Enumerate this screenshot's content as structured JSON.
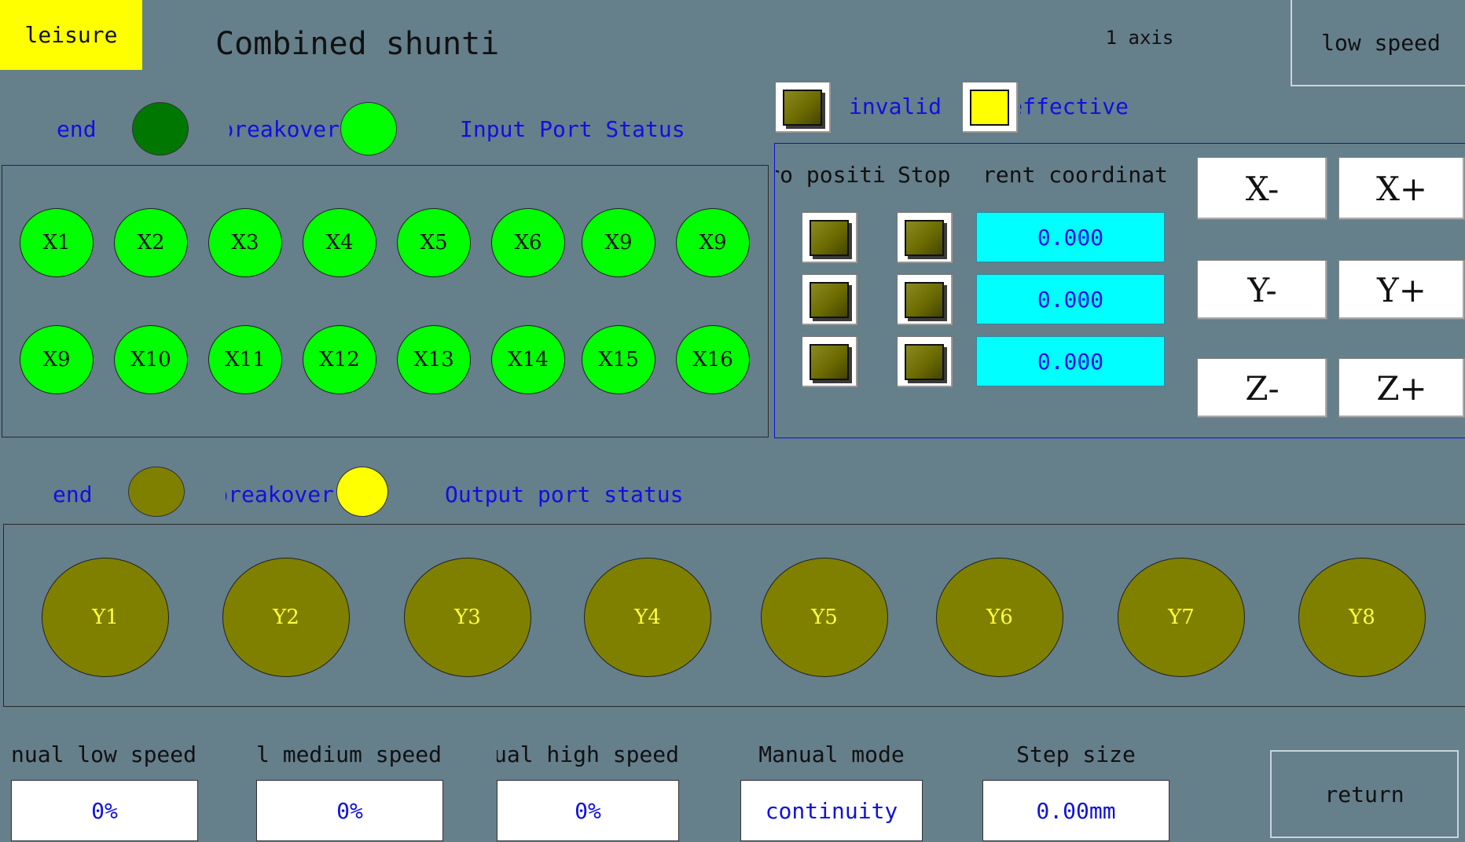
{
  "header": {
    "status": "leisure",
    "title": "Combined shunting",
    "axis": "1 axis",
    "speed_button": "low speed"
  },
  "input_legend": {
    "end_label": "end",
    "breakover_label": "breakover",
    "section_title": "Input Port Status",
    "end_color": "#007700",
    "breakover_color": "#00ff00"
  },
  "input_ports": [
    "X1",
    "X2",
    "X3",
    "X4",
    "X5",
    "X6",
    "X9",
    "X9",
    "X9",
    "X10",
    "X11",
    "X12",
    "X13",
    "X14",
    "X15",
    "X16"
  ],
  "mode_toggles": {
    "invalid_label": "one invalid",
    "effective_label": "effective"
  },
  "axis_table": {
    "headers": [
      "Zero positi",
      "Stop",
      "Current coordinat"
    ],
    "coordinates": [
      "0.000",
      "0.000",
      "0.000"
    ]
  },
  "jog_buttons": [
    "X-",
    "X+",
    "Y-",
    "Y+",
    "Z-",
    "Z+"
  ],
  "output_legend": {
    "end_label": "end",
    "breakover_label": "breakover",
    "section_title": "Output port status",
    "end_color": "#808000",
    "breakover_color": "#ffff00"
  },
  "output_ports": [
    "Y1",
    "Y2",
    "Y3",
    "Y4",
    "Y5",
    "Y6",
    "Y7",
    "Y8"
  ],
  "bottom": {
    "fields": [
      {
        "label": "Manual low speed",
        "value": "0%"
      },
      {
        "label": "Manual medium speed",
        "value": "0%"
      },
      {
        "label": "Manual high speed",
        "value": "0%"
      },
      {
        "label": "Manual mode",
        "value": "continuity"
      },
      {
        "label": "Step size",
        "value": "0.00mm"
      }
    ],
    "return_label": "return"
  }
}
